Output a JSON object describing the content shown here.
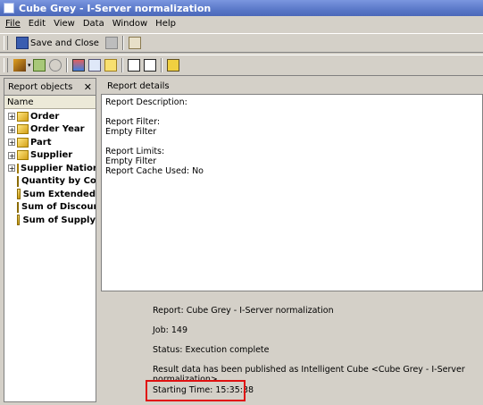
{
  "window": {
    "title": "Cube Grey - I-Server normalization"
  },
  "menu": [
    "File",
    "Edit",
    "View",
    "Data",
    "Window",
    "Help"
  ],
  "toolbar": {
    "save_close_label": "Save and Close"
  },
  "left_panel": {
    "title": "Report objects",
    "column_header": "Name",
    "items": [
      {
        "label": "Order",
        "type": "attribute"
      },
      {
        "label": "Order Year",
        "type": "attribute"
      },
      {
        "label": "Part",
        "type": "attribute"
      },
      {
        "label": "Supplier",
        "type": "attribute"
      },
      {
        "label": "Supplier Nation",
        "type": "attribute"
      },
      {
        "label": "Quantity by Co",
        "type": "metric"
      },
      {
        "label": "Sum Extended",
        "type": "metric"
      },
      {
        "label": "Sum of Discoun",
        "type": "metric"
      },
      {
        "label": "Sum of Supply",
        "type": "metric"
      }
    ]
  },
  "details": {
    "title": "Report details",
    "description_label": "Report Description:",
    "filter_label": "Report Filter:",
    "filter_value": "Empty Filter",
    "limits_label": "Report Limits:",
    "limits_value": "Empty Filter",
    "cache_line": "Report Cache Used: No"
  },
  "status": {
    "report": "Report: Cube Grey - I-Server normalization",
    "job": "Job: 149",
    "state": "Status: Execution complete",
    "published": "Result data has been published as Intelligent Cube <Cube Grey - I-Server normalization>.",
    "start_time": "Starting Time: 15:35:38"
  },
  "colors": {
    "highlight": "#e01010",
    "titlebar": "#5a78c8"
  }
}
